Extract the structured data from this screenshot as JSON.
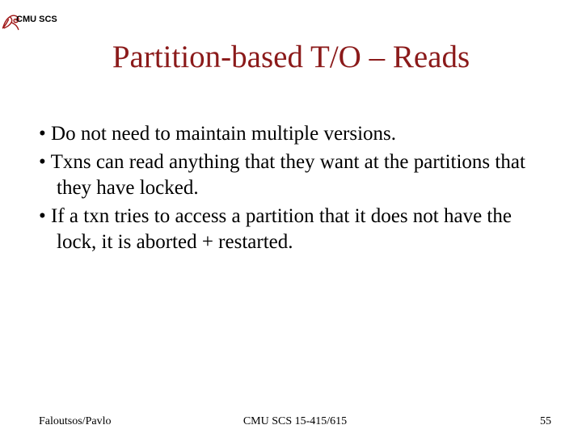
{
  "header": {
    "org_label": "CMU SCS"
  },
  "title": "Partition-based T/O – Reads",
  "bullets": [
    "Do not need to maintain multiple versions.",
    "Txns can read anything that they want at the partitions that they have locked.",
    "If a txn tries to access a partition that it does not have the lock, it is aborted + restarted."
  ],
  "footer": {
    "left": "Faloutsos/Pavlo",
    "center": "CMU SCS 15-415/615",
    "right": "55"
  },
  "colors": {
    "heading": "#8b1a1a"
  }
}
